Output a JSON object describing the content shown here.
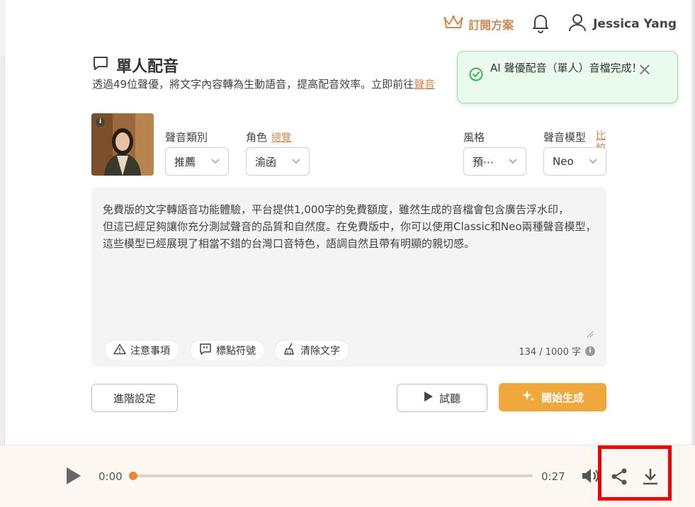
{
  "header": {
    "subscription_label": "訂閱方案",
    "user_name": "Jessica Yang"
  },
  "page": {
    "title": "單人配音",
    "description": "透過49位聲優，將文字內容轉為生動語音，提高配音效率。立即前往",
    "description_link": "聲音"
  },
  "toast": {
    "message": "AI 聲優配音（單人）音檔完成！",
    "close": "✕"
  },
  "voice": {
    "info_badge": "i",
    "category_label": "聲音類別",
    "category_value": "推薦",
    "role_label": "角色",
    "role_link": "總覽",
    "role_value": "渝函",
    "style_label": "風格",
    "style_value": "預⋯",
    "model_label": "聲音模型",
    "model_link": "比較",
    "model_value": "Neo"
  },
  "editor": {
    "lines": [
      "免費版的文字轉語音功能體驗，平台提供1,000字的免費額度，雖然生成的音檔會包含廣告浮水印，",
      "但這已經足夠讓你充分測試聲音的品質和自然度。在免費版中，你可以使用Classic和Neo兩種聲音模型，",
      "這些模型已經展現了相當不錯的台灣口音特色，語調自然且帶有明顯的親切感。"
    ],
    "notice_label": "注意事項",
    "punctuation_label": "標點符號",
    "clear_label": "清除文字",
    "char_count": "134 / 1000 字",
    "info": "i"
  },
  "actions": {
    "advanced_label": "進階設定",
    "preview_label": "試聽",
    "generate_label": "開始生成"
  },
  "player": {
    "current_time": "0:00",
    "duration": "0:27",
    "progress": 0
  },
  "colors": {
    "accent": "#c98a52",
    "primary": "#f0a73c",
    "success_bg": "#eafaec",
    "success_icon": "#3cb552",
    "highlight": "#f00000"
  }
}
